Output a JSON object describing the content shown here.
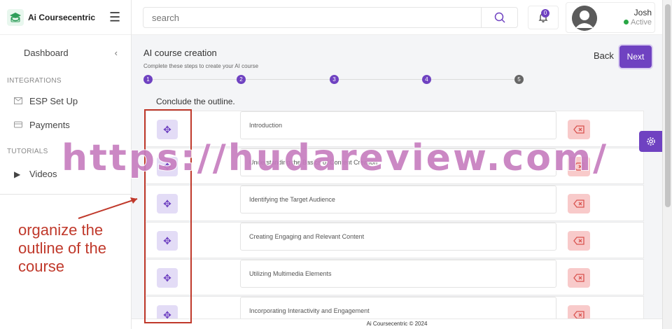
{
  "app": {
    "name": "Ai Coursecentric"
  },
  "sidebar": {
    "dashboard_label": "Dashboard",
    "integrations_label": "INTEGRATIONS",
    "items": [
      {
        "label": "ESP Set Up",
        "icon": "mail-icon"
      },
      {
        "label": "Payments",
        "icon": "card-icon"
      }
    ],
    "tutorials_label": "TUTORIALS",
    "tutorial_items": [
      {
        "label": "Videos",
        "icon": "play-icon"
      }
    ]
  },
  "topbar": {
    "search_placeholder": "search",
    "notification_count": "0",
    "user": {
      "name": "Josh",
      "status": "Active"
    }
  },
  "page": {
    "title": "AI course creation",
    "subtitle": "Complete these steps to create your AI course",
    "back_label": "Back",
    "next_label": "Next",
    "steps": [
      "1",
      "2",
      "3",
      "4",
      "5"
    ],
    "current_step": 4,
    "outline_heading": "Conclude the outline.",
    "outline_items": [
      "Introduction",
      "Understanding the Basics of Content Creation",
      "Identifying the Target Audience",
      "Creating Engaging and Relevant Content",
      "Utilizing Multimedia Elements",
      "Incorporating Interactivity and Engagement"
    ],
    "footer": "Ai Coursecentric © 2024"
  },
  "overlay": {
    "annotation": "organize the outline of the course",
    "watermark": "https://hudareview.com/"
  },
  "colors": {
    "accent": "#6f42c1",
    "danger": "#f8caca",
    "annotation": "#c0392b",
    "watermark": "#c77ec0"
  }
}
